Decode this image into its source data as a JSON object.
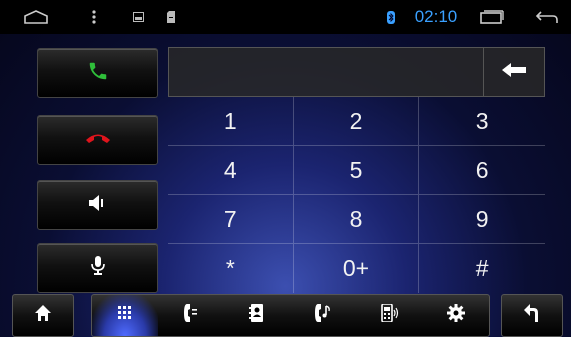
{
  "status_bar": {
    "time": "02:10",
    "icons": [
      "home-outline-icon",
      "menu-dots-icon",
      "image-icon",
      "sd-card-icon",
      "bluetooth-icon",
      "recent-apps-icon",
      "back-arrow-icon"
    ],
    "time_color": "#3aa0ff"
  },
  "call_controls": {
    "buttons": [
      "answer-call-icon",
      "hang-up-icon",
      "volume-icon",
      "microphone-icon"
    ],
    "colors": {
      "answer": "#2fbf3a",
      "hangup": "#e0141c"
    }
  },
  "dialer": {
    "number": "",
    "keys": [
      "1",
      "2",
      "3",
      "4",
      "5",
      "6",
      "7",
      "8",
      "9",
      "*",
      "0+",
      "#"
    ]
  },
  "bottom_bar": {
    "tabs": [
      "dialpad-icon",
      "call-log-icon",
      "contacts-icon",
      "music-icon",
      "device-icon",
      "settings-icon"
    ],
    "active_tab": 0
  }
}
